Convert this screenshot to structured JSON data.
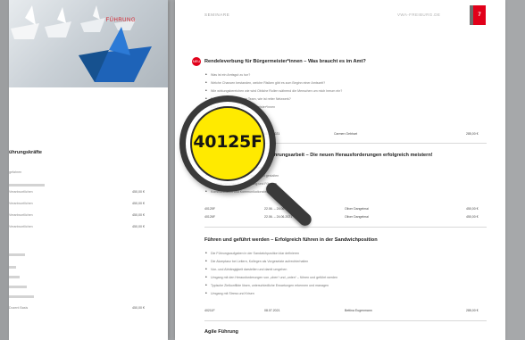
{
  "left_page": {
    "brand": "FÜHRUNG",
    "heading": "ührungskräfte",
    "rows": [
      "gefahren",
      "Verantwortlichen",
      "Verantwortlichen",
      "Verantwortlichen",
      "Verantwortlichen"
    ],
    "prices": [
      "450,00 €",
      "450,00 €",
      "450,00 €",
      "450,00 €"
    ],
    "lower_rows": [
      "",
      ""
    ],
    "bottom_left": "Dozent Basis",
    "bottom_price": "450,00 €"
  },
  "right_page": {
    "header_left": "SEMINARE",
    "header_right": "VWA-FREIBURG.DE",
    "page_number": "7",
    "courses": [
      {
        "icon": "NEU",
        "title": "Rendeleverbung für Bürgermeister*innen – Was braucht es im Amt?",
        "bullets": [
          "Was ist ein Amtsgut zu tun?",
          "Welche Chancen bestanden, welche Risiken gibt es zum Beginn einer Amtszeit?",
          "Wie wirkungsbereichen wie wird Obliche Rollen während die Menschen um mich herum ein?",
          "Die Umstellung mit einem Team, wie ist reiter Netzwerk?",
          "Das Recht und Staat für Bürgermeister*innen"
        ],
        "meta": [
          {
            "icon": "calendar-icon",
            "text": "11.03.2021"
          },
          {
            "icon": "person-icon",
            "text": "Carmen Gebhart"
          },
          {
            "icon": "price-icon",
            "text": "285,00 €"
          }
        ]
      },
      {
        "icon": "",
        "title": "Führungsarbeit – Die neuen Herausforderungen erfolgreich meistern!",
        "bullets": [
          "Die Herausforderungen an die Führung",
          "Die Führung zu meistern, Führung gut gestalten",
          "Balance zwischen Digitalisierung und Führung",
          "Kommunikation und Kommunikationstechniken"
        ],
        "meta": [
          {
            "icon": "id-icon",
            "text": "40125F"
          },
          {
            "icon": "calendar-icon",
            "text": "22.06. – 24.06.2021"
          },
          {
            "icon": "person-icon",
            "text": "Oliver Dangelmai"
          },
          {
            "icon": "price-icon",
            "text": "450,00 €"
          },
          {
            "icon": "id-icon",
            "text": "40126F"
          },
          {
            "icon": "calendar-icon",
            "text": "22.06. – 24.06.2021"
          },
          {
            "icon": "person-icon",
            "text": "Oliver Dangelmai"
          },
          {
            "icon": "price-icon",
            "text": "450,00 €"
          }
        ]
      },
      {
        "icon": "",
        "title": "Führen und geführt werden – Erfolgreich führen in der Sandwichposition",
        "bullets": [
          "Die Führungsaufgaben in der Sandwichposition klar definieren",
          "Die Akzeptanz bei Leitern, Kollegen als Vorgesetzte aufrechterhalten",
          "Von- und Abhängigkeit darstellen und damit umgehen",
          "Umgang mit den Herausforderungen von „oben“ und „unten“ – führen und geführt werden",
          "Typische Zielkonflikte lösen, unterschiedliche Erwartungen erkennen und managen",
          "Umgang mit Stress und Krisen"
        ],
        "meta": [
          {
            "icon": "id-icon",
            "text": "40211F"
          },
          {
            "icon": "calendar-icon",
            "text": "08.07.2021"
          },
          {
            "icon": "person-icon",
            "text": "Bettina Eugenmann"
          },
          {
            "icon": "price-icon",
            "text": "285,00 €"
          }
        ]
      },
      {
        "icon": "",
        "title": "Agile Führung",
        "bullets": [],
        "meta": []
      }
    ]
  },
  "magnifier": {
    "code": "40125F"
  },
  "colors": {
    "accent_red": "#e1001a",
    "lens_yellow": "#ffea00",
    "background_gray": "#a6a8aa"
  }
}
